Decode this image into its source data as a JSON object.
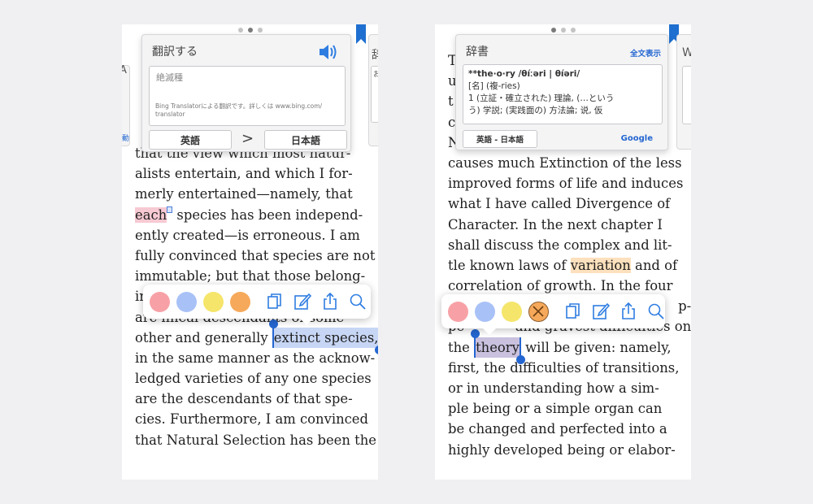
{
  "left_screen": {
    "translate_panel": {
      "title": "翻訳する",
      "input_text": "絶滅種",
      "attribution": "Bing Translatorによる翻訳です。詳しくは www.bing.com/translator をご覧ください。",
      "attribution_line1": "Bing Translatorによる翻訳です。詳しくは www.bing.com/",
      "attribution_line2": "translator",
      "source_lang": "英語",
      "arrow": ">",
      "target_lang": "日本語"
    },
    "left_peek": {
      "top": "A",
      "mid": "動"
    },
    "right_peek": {
      "top": "辞",
      "mid": "お"
    },
    "text_lines": {
      "l0": "that the view which most natur-",
      "l1": "alists entertain, and which I for-",
      "l2": "merly entertained—namely, that",
      "l3_hl": "each",
      "l3_rest": " species has been independ-",
      "l4": "ently created—is erroneous. I am",
      "l5": "fully convinced that species are not",
      "l6": "immutable; but that those belong-",
      "l7": "in",
      "l8": "are lineal descendants of some",
      "l9_pre": "other and generally ",
      "l9_sel": "extinct species,",
      "l10": "in the same manner as the acknow-",
      "l11": "ledged varieties of any one species",
      "l12": "are the descendants of that spe-",
      "l13": "cies. Furthermore, I am convinced",
      "l14": "that Natural Selection has been the"
    }
  },
  "right_screen": {
    "dict_panel": {
      "title": "辞書",
      "full_view": "全文表示",
      "headword": "**the·o·ry /θíːəri | θíəri/",
      "pos": "[名] (複-ries)",
      "def1": "1 (立証・確立された) 理論, (…という",
      "def2": "う) 学説; (実践面の) 方法論; 说, 仮",
      "lang": "英語 - 日本語",
      "google": "Google"
    },
    "right_peek": {
      "top": "W"
    },
    "text_lines": {
      "r0": "T",
      "r1": "u",
      "r2": "t",
      "r3": "c",
      "r4": "N",
      "r5": "causes much Extinction of the less",
      "r6": "improved forms of life and induces",
      "r7": "what I have called Divergence of",
      "r8": "Character. In the next chapter I",
      "r9": "shall discuss the complex and lit-",
      "r10_pre": "tle known laws of ",
      "r10_hl": "variation",
      "r10_post": " and of",
      "r11": "correlation of growth. In the four",
      "r12": "p",
      "r12b": "p-",
      "r13": "pe            and gravest difficulties on",
      "r14_pre": "the ",
      "r14_sel": "theory",
      "r14_post": " will be given: namely,",
      "r15": "first, the difficulties of transitions,",
      "r16": "or in understanding how a sim-",
      "r17": "ple being or a simple organ can",
      "r18": "be changed and perfected into a",
      "r19": "highly developed being or elabor-"
    }
  },
  "colors": {
    "swatch_red": "#f7a1a6",
    "swatch_blue": "#a8c1f7",
    "swatch_yellow": "#f5e56b",
    "swatch_orange": "#f6a95a",
    "accent": "#2466d1"
  }
}
